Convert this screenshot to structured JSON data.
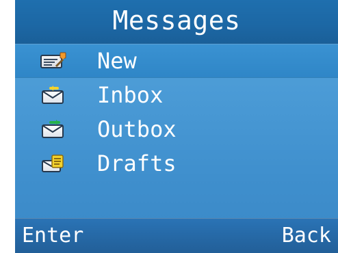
{
  "header": {
    "title": "Messages"
  },
  "menu": {
    "items": [
      {
        "label": "New",
        "icon": "new-message-icon",
        "selected": true
      },
      {
        "label": "Inbox",
        "icon": "inbox-icon",
        "selected": false
      },
      {
        "label": "Outbox",
        "icon": "outbox-icon",
        "selected": false
      },
      {
        "label": "Drafts",
        "icon": "drafts-icon",
        "selected": false
      }
    ]
  },
  "softkeys": {
    "left": "Enter",
    "right": "Back"
  },
  "colors": {
    "screen_background": "#4b9bd6",
    "title_bar": "#1f6fae",
    "selected_row": "#2f86c7",
    "softkey_bar": "#2a73b5",
    "text": "#ffffff"
  }
}
